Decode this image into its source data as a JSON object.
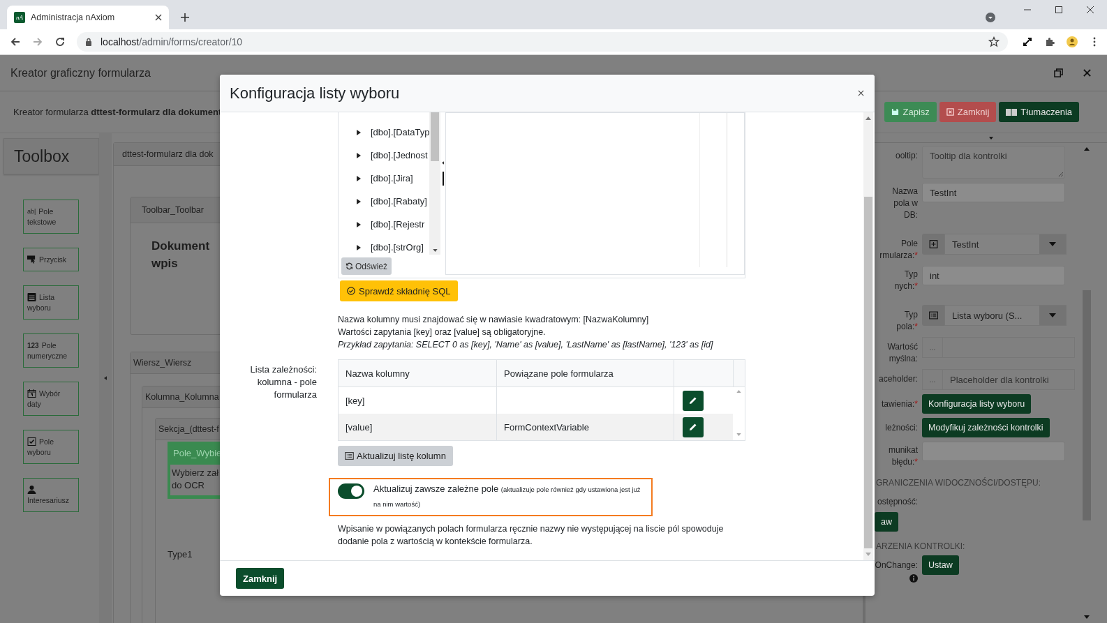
{
  "browser": {
    "tab_title": "Administracja nAxiom",
    "favicon": "nA",
    "url_host": "localhost",
    "url_path": "/admin/forms/creator/10"
  },
  "app": {
    "title": "Kreator graficzny formularza",
    "subtitle_prefix": "Kreator formularza",
    "subtitle_name": "dttest-formularz dla dokument",
    "actions": [
      {
        "label": "Zapisz",
        "kind": "save"
      },
      {
        "label": "Zamknij",
        "kind": "close"
      },
      {
        "label": "Tłumaczenia",
        "kind": "translate"
      }
    ]
  },
  "toolbox": {
    "title": "Toolbox",
    "items": [
      {
        "kind": "text",
        "icon_text": "ab|",
        "lines": [
          "Pole",
          "tekstowe"
        ]
      },
      {
        "kind": "button",
        "lines": [
          "Przycisk"
        ]
      },
      {
        "kind": "list",
        "lines": [
          "Lista",
          "wyboru"
        ]
      },
      {
        "kind": "number",
        "icon_text": "123",
        "lines": [
          "Pole",
          "numeryczne"
        ]
      },
      {
        "kind": "date",
        "lines": [
          "Wybór",
          "daty"
        ]
      },
      {
        "kind": "check",
        "lines": [
          "Pole",
          "wyboru"
        ]
      },
      {
        "kind": "person",
        "lines": [
          "Interesariusz"
        ]
      }
    ]
  },
  "canvas": {
    "form_tab": "dttest-formularz dla dok",
    "toolbar": "Toolbar_Toolbar",
    "heading": [
      "Dokument",
      "wpis"
    ],
    "row": "Wiersz_Wiersz",
    "column": "Kolumna_Kolumna",
    "section": "Sekcja_(dttest-f",
    "field_title": "Pole_Wybie",
    "field_text": [
      "Wybierz zał",
      "do OCR"
    ],
    "type_label": "Type1"
  },
  "properties": [
    {
      "kind": "textarea",
      "lines": [
        "ooltip:"
      ],
      "placeholder": "Tooltip dla kontrolki"
    },
    {
      "kind": "input",
      "lines": [
        "Nazwa",
        "pola w",
        "DB:"
      ],
      "value": "TestInt"
    },
    {
      "kind": "select_add",
      "lines": [
        "Pole",
        "rmularza:"
      ],
      "mark": "*",
      "value": "TestInt"
    },
    {
      "kind": "input",
      "lines": [
        "Typ",
        "nych:"
      ],
      "mark": "*",
      "value": "int"
    },
    {
      "kind": "select_icon",
      "lines": [
        "Typ",
        "pola:"
      ],
      "mark": "*",
      "value": "Lista wyboru (S..."
    },
    {
      "kind": "dots_input",
      "lines": [
        "Wartość",
        "myślna:"
      ],
      "dots": "..."
    },
    {
      "kind": "dots_input",
      "lines": [
        "aceholder:"
      ],
      "dots": "...",
      "placeholder": "Placeholder dla kontrolki"
    },
    {
      "kind": "button",
      "lines": [
        "tawienia:"
      ],
      "mark": "*",
      "button": "Konfiguracja listy wyboru"
    },
    {
      "kind": "button",
      "lines": [
        "leżności:"
      ],
      "button": "Modyfikuj zależności kontrolki"
    },
    {
      "kind": "input",
      "lines": [
        "munikat",
        "błędu:"
      ],
      "mark": "*"
    },
    {
      "kind": "heading",
      "lines": [
        "GRANICZENIA WIDOCZNOŚCI/DOSTĘPU:"
      ]
    },
    {
      "kind": "plain",
      "lines": [
        "ostępność:"
      ]
    },
    {
      "kind": "button_only",
      "button": "aw"
    },
    {
      "kind": "heading",
      "lines": [
        "ARZENIA KONTROLKI:"
      ]
    },
    {
      "kind": "button",
      "lines": [
        "OnChange:"
      ],
      "button": "Ustaw",
      "info": true
    }
  ],
  "modal": {
    "title": "Konfiguracja listy wyboru",
    "tables": [
      "[dbo].[DataTyp",
      "[dbo].[Jednost",
      "[dbo].[Jira]",
      "[dbo].[Rabaty]",
      "[dbo].[Rejestr",
      "[dbo].[strOrg]"
    ],
    "refresh": "Odśwież",
    "check_sql": "Sprawdź składnię SQL",
    "info": [
      "Nazwa kolumny musi znajdować się w nawiasie kwadratowym: [NazwaKolumny]",
      "Wartości zapytania [key] oraz [value] są obligatoryjne."
    ],
    "example": "Przykład zapytania: SELECT 0 as [key], 'Name' as [value], 'LastName' as [lastName], '123' as [id]",
    "deps_label": [
      "Lista zależności:",
      "kolumna - pole",
      "formularza"
    ],
    "columns": [
      "Nazwa kolumny",
      "Powiązane pole formularza"
    ],
    "rows": [
      {
        "column": "[key]"
      },
      {
        "column": "[value]",
        "field": "FormContextVariable"
      }
    ],
    "update_columns": "Aktualizuj listę kolumn",
    "toggle": {
      "on": true,
      "label": "Aktualizuj zawsze zależne pole",
      "hint": "(aktualizuje pole również gdy ustawiona jest już na nim wartość)"
    },
    "note": "Wpisanie w powiązanych polach formularza ręcznie nazwy nie występującej na liscie pól spowoduje dodanie pola z wartością w kontekście formularza.",
    "close": "Zamknij"
  }
}
